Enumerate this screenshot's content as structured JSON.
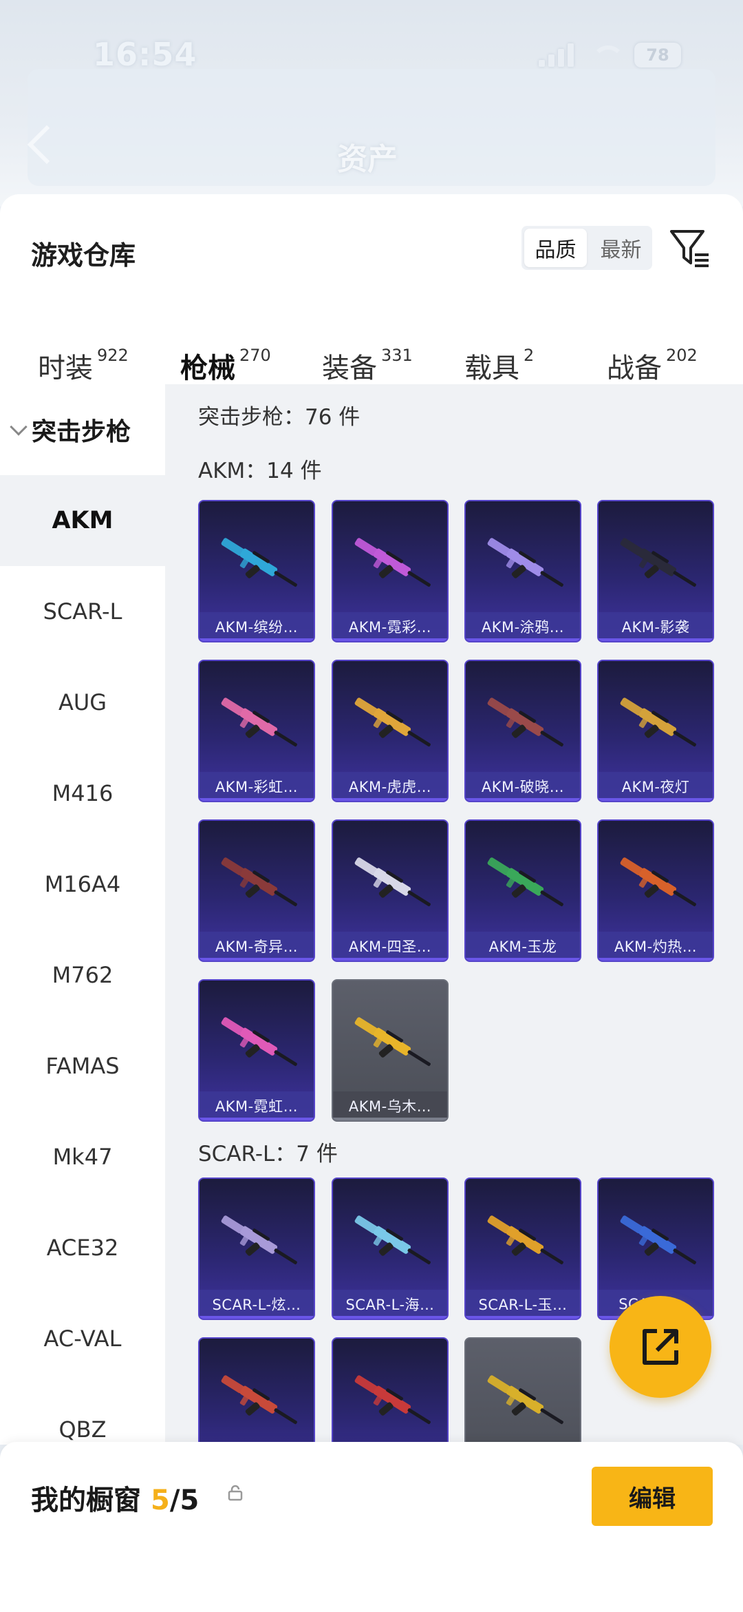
{
  "status_bar": {
    "time": "16:54",
    "battery": "78"
  },
  "nav": {
    "title": "资产"
  },
  "header": {
    "title": "游戏仓库",
    "sort": [
      "品质",
      "最新"
    ],
    "active_sort": "品质"
  },
  "tabs": [
    {
      "label": "时装",
      "count": "922"
    },
    {
      "label": "枪械",
      "count": "270"
    },
    {
      "label": "装备",
      "count": "331"
    },
    {
      "label": "载具",
      "count": "2"
    },
    {
      "label": "战备",
      "count": "202"
    }
  ],
  "sidebar": {
    "group_label": "突击步枪",
    "items": [
      "AKM",
      "SCAR-L",
      "AUG",
      "M416",
      "M16A4",
      "M762",
      "FAMAS",
      "Mk47",
      "ACE32",
      "AC-VAL",
      "QBZ"
    ]
  },
  "content": {
    "category_head": "突击步枪：76 件",
    "sections": [
      {
        "head": "AKM：14 件",
        "cards": [
          {
            "label": "AKM-缤纷…",
            "color": "#2fa8d8"
          },
          {
            "label": "AKM-霓彩…",
            "color": "#c05ad8"
          },
          {
            "label": "AKM-涂鸦…",
            "color": "#9f8ce8"
          },
          {
            "label": "AKM-影袭",
            "color": "#2a2a3a"
          },
          {
            "label": "AKM-彩虹…",
            "color": "#e06aa8"
          },
          {
            "label": "AKM-虎虎…",
            "color": "#e0a63a"
          },
          {
            "label": "AKM-破晓…",
            "color": "#9a4a4a"
          },
          {
            "label": "AKM-夜灯",
            "color": "#d4a23a"
          },
          {
            "label": "AKM-奇异…",
            "color": "#8a3a3a"
          },
          {
            "label": "AKM-四圣…",
            "color": "#d8d8e8"
          },
          {
            "label": "AKM-玉龙",
            "color": "#3aa85a"
          },
          {
            "label": "AKM-灼热…",
            "color": "#d8612a"
          },
          {
            "label": "AKM-霓虹…",
            "color": "#e05ab8"
          },
          {
            "label": "AKM-乌木…",
            "color": "#e8b52a",
            "grey": true
          }
        ]
      },
      {
        "head": "SCAR-L：7 件",
        "cards": [
          {
            "label": "SCAR-L-炫…",
            "color": "#a89ad8"
          },
          {
            "label": "SCAR-L-海…",
            "color": "#7ac8e8"
          },
          {
            "label": "SCAR-L-玉…",
            "color": "#e0a02a"
          },
          {
            "label": "SCAR-L-…",
            "color": "#3a6ad8"
          },
          {
            "label": "",
            "color": "#c84a3a"
          },
          {
            "label": "",
            "color": "#c83a3a"
          },
          {
            "label": "",
            "color": "#d8b02a",
            "grey": true
          }
        ]
      }
    ]
  },
  "bottom": {
    "title": "我的橱窗",
    "used": "5",
    "total": "/5",
    "edit_label": "编辑"
  },
  "accent_color": "#f8b516"
}
